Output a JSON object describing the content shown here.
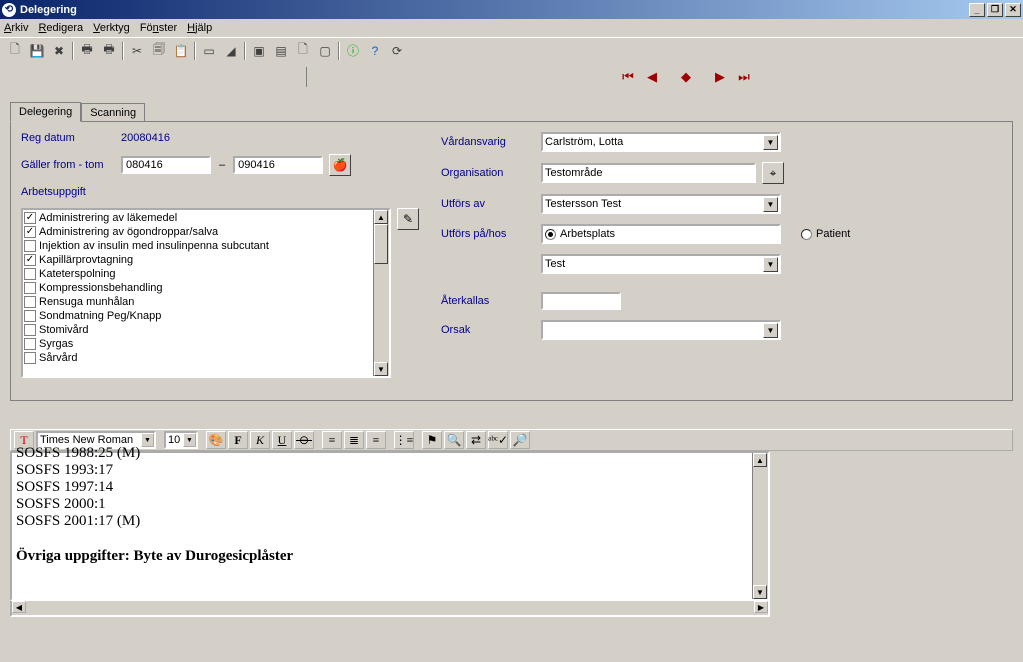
{
  "window": {
    "title": "Delegering"
  },
  "menu": {
    "arkiv": "Arkiv",
    "redigera": "Redigera",
    "verktyg": "Verktyg",
    "fonster": "Fönster",
    "hjalp": "Hjälp"
  },
  "tabs": {
    "delegering": "Delegering",
    "scanning": "Scanning"
  },
  "left": {
    "regdatum_lbl": "Reg datum",
    "regdatum_val": "20080416",
    "galler_lbl": "Gäller from - tom",
    "from": "080416",
    "sep": "–",
    "tom": "090416",
    "arbetsuppgift_lbl": "Arbetsuppgift",
    "tasks": [
      {
        "label": "Administrering av läkemedel",
        "checked": true
      },
      {
        "label": "Administrering av ögondroppar/salva",
        "checked": true
      },
      {
        "label": "Injektion av insulin med insulinpenna subcutant",
        "checked": false
      },
      {
        "label": "Kapillärprovtagning",
        "checked": true
      },
      {
        "label": "Kateterspolning",
        "checked": false
      },
      {
        "label": "Kompressionsbehandling",
        "checked": false
      },
      {
        "label": "Rensuga munhålan",
        "checked": false
      },
      {
        "label": "Sondmatning Peg/Knapp",
        "checked": false
      },
      {
        "label": "Stomivård",
        "checked": false
      },
      {
        "label": "Syrgas",
        "checked": false
      },
      {
        "label": "Sårvård",
        "checked": false
      }
    ]
  },
  "right": {
    "vard_lbl": "Vårdansvarig",
    "vard_val": "Carlström, Lotta",
    "org_lbl": "Organisation",
    "org_val": "Testområde",
    "utfors_lbl": "Utförs av",
    "utfors_val": "Testersson Test",
    "utforspa_lbl": "Utförs på/hos",
    "r_arbetsplats": "Arbetsplats",
    "r_patient": "Patient",
    "drop_val": "Test",
    "aterkallas_lbl": "Återkallas",
    "aterkallas_val": "",
    "orsak_lbl": "Orsak",
    "orsak_val": ""
  },
  "editor": {
    "font": "Times New Roman",
    "size": "10",
    "lines": [
      "SOSFS 1988:25 (M)",
      "SOSFS 1993:17",
      "SOSFS 1997:14",
      "SOSFS 2000:1",
      "SOSFS 2001:17 (M)"
    ],
    "bold_line": "Övriga uppgifter: Byte av Durogesicplåster"
  }
}
